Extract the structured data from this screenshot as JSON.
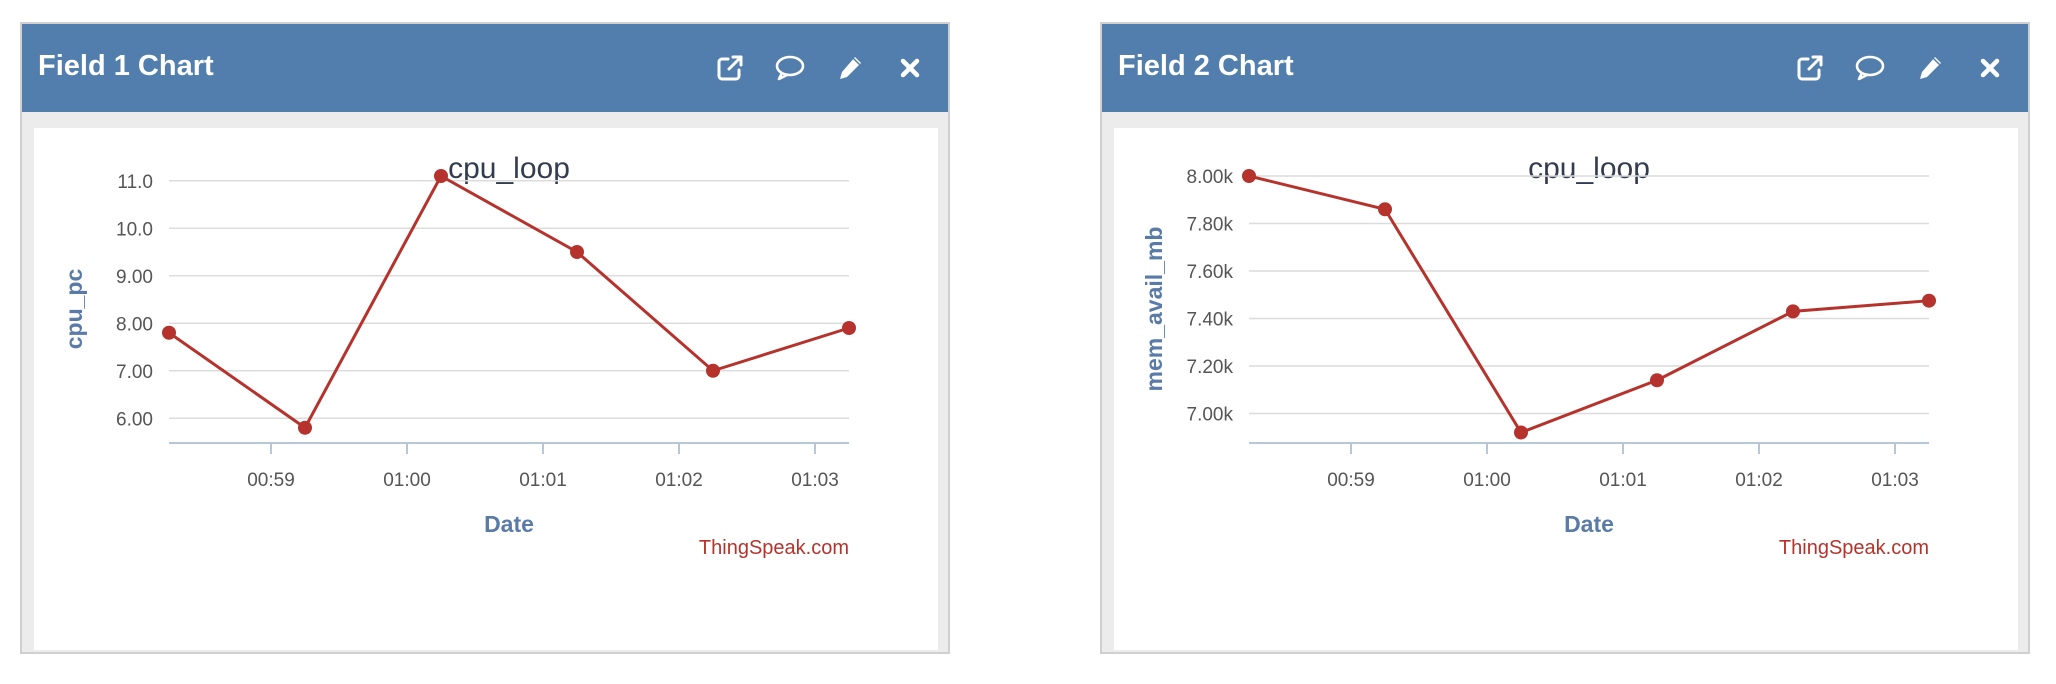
{
  "panels": [
    {
      "title": "Field 1 Chart",
      "icons": [
        "external-link-icon",
        "comment-icon",
        "pencil-icon",
        "close-icon"
      ]
    },
    {
      "title": "Field 2 Chart",
      "icons": [
        "external-link-icon",
        "comment-icon",
        "pencil-icon",
        "close-icon"
      ]
    }
  ],
  "colors": {
    "header": "#517ead",
    "series": "#b5332c",
    "axis_title": "#5a7ba8",
    "chart_title": "#333b4f",
    "credit": "#b5332c"
  },
  "chart_data": [
    {
      "type": "line",
      "title": "cpu_loop",
      "xlabel": "Date",
      "ylabel": "cpu_pc",
      "credit": "ThingSpeak.com",
      "x": [
        "00:58:15",
        "00:59:15",
        "01:00:15",
        "01:01:15",
        "01:02:15",
        "01:03:15"
      ],
      "series": [
        {
          "values": [
            7.8,
            5.8,
            11.1,
            9.5,
            7.0,
            7.9
          ]
        }
      ],
      "xlim": [
        "00:58:15",
        "01:03:15"
      ],
      "xticks": [
        "00:59",
        "01:00",
        "01:01",
        "01:02",
        "01:03"
      ],
      "ylim": [
        5.5,
        11.1
      ],
      "yticks": [
        "6.00",
        "7.00",
        "8.00",
        "9.00",
        "10.0",
        "11.0"
      ],
      "ytick_values": [
        6,
        7,
        8,
        9,
        10,
        11
      ],
      "grid": true,
      "legend": "none"
    },
    {
      "type": "line",
      "title": "cpu_loop",
      "xlabel": "Date",
      "ylabel": "mem_avail_mb",
      "credit": "ThingSpeak.com",
      "x": [
        "00:58:15",
        "00:59:15",
        "01:00:15",
        "01:01:15",
        "01:02:15",
        "01:03:15"
      ],
      "series": [
        {
          "values": [
            8000,
            7860,
            6920,
            7140,
            7430,
            7475
          ]
        }
      ],
      "xlim": [
        "00:58:15",
        "01:03:15"
      ],
      "xticks": [
        "00:59",
        "01:00",
        "01:01",
        "01:02",
        "01:03"
      ],
      "ylim": [
        6880,
        8000
      ],
      "yticks": [
        "7.00k",
        "7.20k",
        "7.40k",
        "7.60k",
        "7.80k",
        "8.00k"
      ],
      "ytick_values": [
        7000,
        7200,
        7400,
        7600,
        7800,
        8000
      ],
      "grid": true,
      "legend": "none"
    }
  ]
}
